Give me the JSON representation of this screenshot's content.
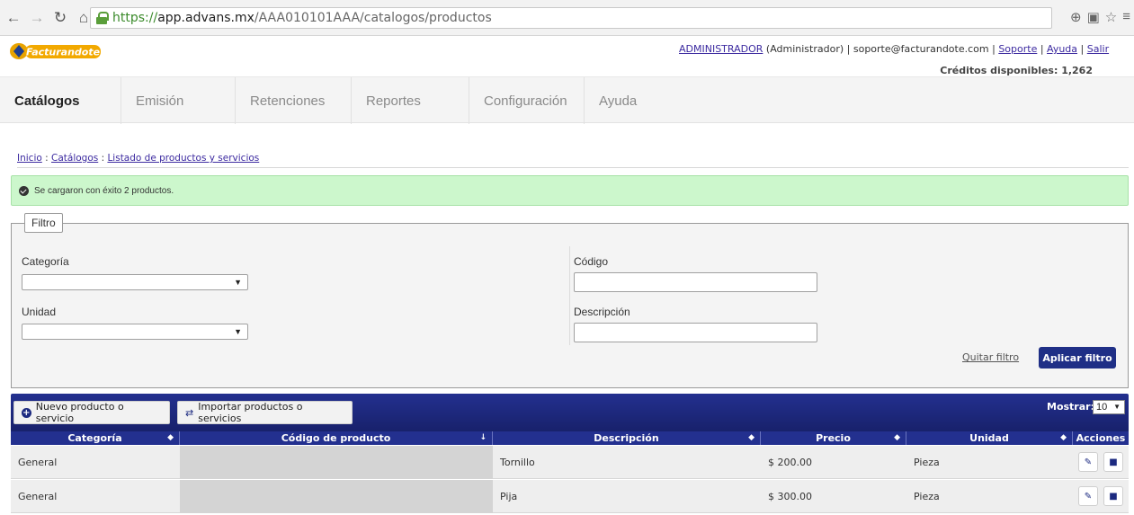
{
  "browser": {
    "url_https": "https://",
    "url_host": "app.advans.mx",
    "url_path": "/AAA010101AAA/catalogos/productos"
  },
  "header": {
    "logo_text": "Facturandote",
    "user_name": "ADMINISTRADOR",
    "user_role": "(Administrador)",
    "support_email": "soporte@facturandote.com",
    "link_support": "Soporte",
    "link_help": "Ayuda",
    "link_logout": "Salir",
    "credits": "Créditos disponibles: 1,262"
  },
  "menu": [
    {
      "label": "Catálogos",
      "active": true
    },
    {
      "label": "Emisión"
    },
    {
      "label": "Retenciones"
    },
    {
      "label": "Reportes"
    },
    {
      "label": "Configuración"
    },
    {
      "label": "Ayuda"
    }
  ],
  "breadcrumb": {
    "home": "Inicio",
    "catalogs": "Catálogos",
    "current": "Listado de productos y servicios"
  },
  "alert": {
    "text": "Se cargaron con éxito 2 productos."
  },
  "filter": {
    "legend": "Filtro",
    "category_label": "Categoría",
    "category_value": "",
    "unit_label": "Unidad",
    "unit_value": "",
    "code_label": "Código",
    "code_value": "",
    "description_label": "Descripción",
    "description_value": "",
    "clear_label": "Quitar filtro",
    "apply_label": "Aplicar filtro"
  },
  "toolbar": {
    "new_label": "Nuevo producto o servicio",
    "import_label": "Importar productos o servicios",
    "show_label": "Mostrar:",
    "show_value": "10"
  },
  "table": {
    "columns": [
      "Categoría",
      "Código de producto",
      "Descripción",
      "Precio",
      "Unidad",
      "Acciones"
    ],
    "rows": [
      {
        "category": "General",
        "code": "",
        "description": "Tornillo",
        "price": "$ 200.00",
        "unit": "Pieza"
      },
      {
        "category": "General",
        "code": "",
        "description": "Pija",
        "price": "$ 300.00",
        "unit": "Pieza"
      }
    ]
  },
  "colors": {
    "navy": "#23308f",
    "success_bg": "#ccf7cc",
    "link": "#3c2aa0"
  }
}
